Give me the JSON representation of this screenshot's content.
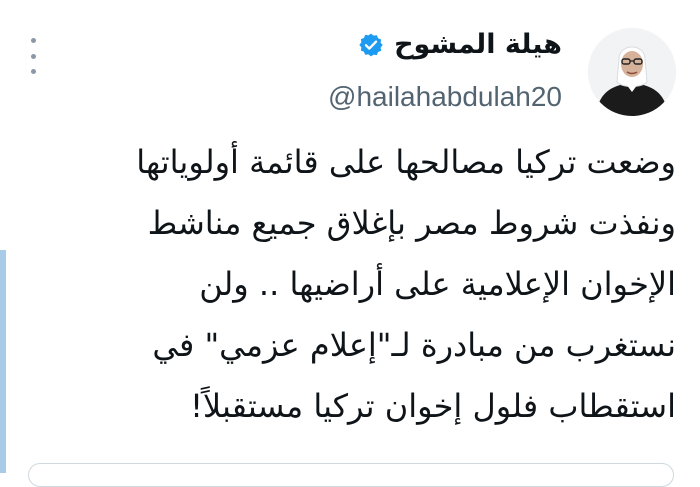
{
  "tweet": {
    "author": {
      "display_name": "هيلة المشوح",
      "handle": "@hailahabdulah20",
      "verified": true,
      "avatar_icon": "profile-photo"
    },
    "text_lines": [
      "وضعت تركيا مصالحها على قائمة أولوياتها",
      "ونفذت شروط مصر بإغلاق جميع مناشط",
      "الإخوان الإعلامية على أراضيها ..  ولن",
      "نستغرب من مبادرة لـ\"إعلام عزمي\" في",
      "استقطاب فلول إخوان تركيا مستقبلاً!"
    ],
    "more_icon": "more-options-icon",
    "colors": {
      "text": "#0f1419",
      "secondary": "#536471",
      "verified": "#1d9bf0",
      "accent_bar": "#a9cbe8"
    }
  }
}
